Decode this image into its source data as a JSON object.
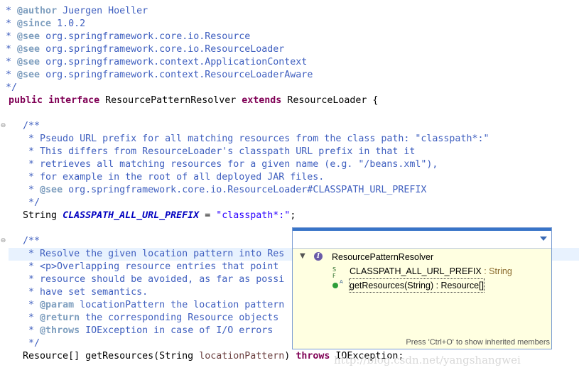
{
  "editor": {
    "lines": {
      "l1": [
        " * ",
        "@author",
        " Juergen Hoeller"
      ],
      "l2": [
        " * ",
        "@since",
        " 1.0.2"
      ],
      "l3": [
        " * ",
        "@see",
        " org.springframework.core.io.Resource"
      ],
      "l4": [
        " * ",
        "@see",
        " org.springframework.core.io.ResourceLoader"
      ],
      "l5": [
        " * ",
        "@see",
        " org.springframework.context.ApplicationContext"
      ],
      "l6": [
        " * ",
        "@see",
        " org.springframework.context.ResourceLoaderAware"
      ],
      "l7": " */",
      "l8": [
        "public",
        "interface",
        " ResourcePatternResolver ",
        "extends",
        " ResourceLoader {"
      ],
      "l10": "    /**",
      "l11": "     * Pseudo URL prefix for all matching resources from the class path: \"classpath*:\"",
      "l12": "     * This differs from ResourceLoader's classpath URL prefix in that it",
      "l13": "     * retrieves all matching resources for a given name (e.g. \"/beans.xml\"),",
      "l14": "     * for example in the root of all deployed JAR files.",
      "l15": [
        "     * ",
        "@see",
        " org.springframework.core.io.ResourceLoader#CLASSPATH_URL_PREFIX"
      ],
      "l16": "     */",
      "l17": [
        "    String ",
        "CLASSPATH_ALL_URL_PREFIX",
        " = ",
        "\"classpath*:\"",
        ";"
      ],
      "l19": "    /**",
      "l20": "     * Resolve the given location pattern into Res",
      "l21": "     * <p>Overlapping resource entries that point",
      "l22": "     * resource should be avoided, as far as possi",
      "l23": "     * have set semantics.",
      "l24": [
        "     * ",
        "@param",
        " locationPattern the location pattern"
      ],
      "l25": [
        "     * ",
        "@return",
        " the corresponding Resource objects"
      ],
      "l26": [
        "     * ",
        "@throws",
        " IOException in case of I/O errors"
      ],
      "l27": "     */",
      "l28": [
        "    Resource[] getResources(String ",
        "locationPattern",
        ") ",
        "throws",
        " IOException;"
      ]
    }
  },
  "outline_popup": {
    "root_label": "ResourcePatternResolver",
    "field_label": "CLASSPATH_ALL_URL_PREFIX",
    "field_type": " : String",
    "field_icon_sup": "S F",
    "method_label": "getResources(String) : Resource[]",
    "method_icon_sup": "A",
    "status_text": "Press 'Ctrl+O' to show inherited members"
  },
  "watermark": "http://blog.csdn.net/yangshangwei",
  "colors": {
    "comment": "#3f5fbf",
    "javadoc_tag": "#7f9fbf",
    "keyword": "#7f0055",
    "constant_field": "#0000c0",
    "string": "#2a00ff",
    "popup_bg": "#ffffe1",
    "popup_border": "#7a9cd3"
  }
}
